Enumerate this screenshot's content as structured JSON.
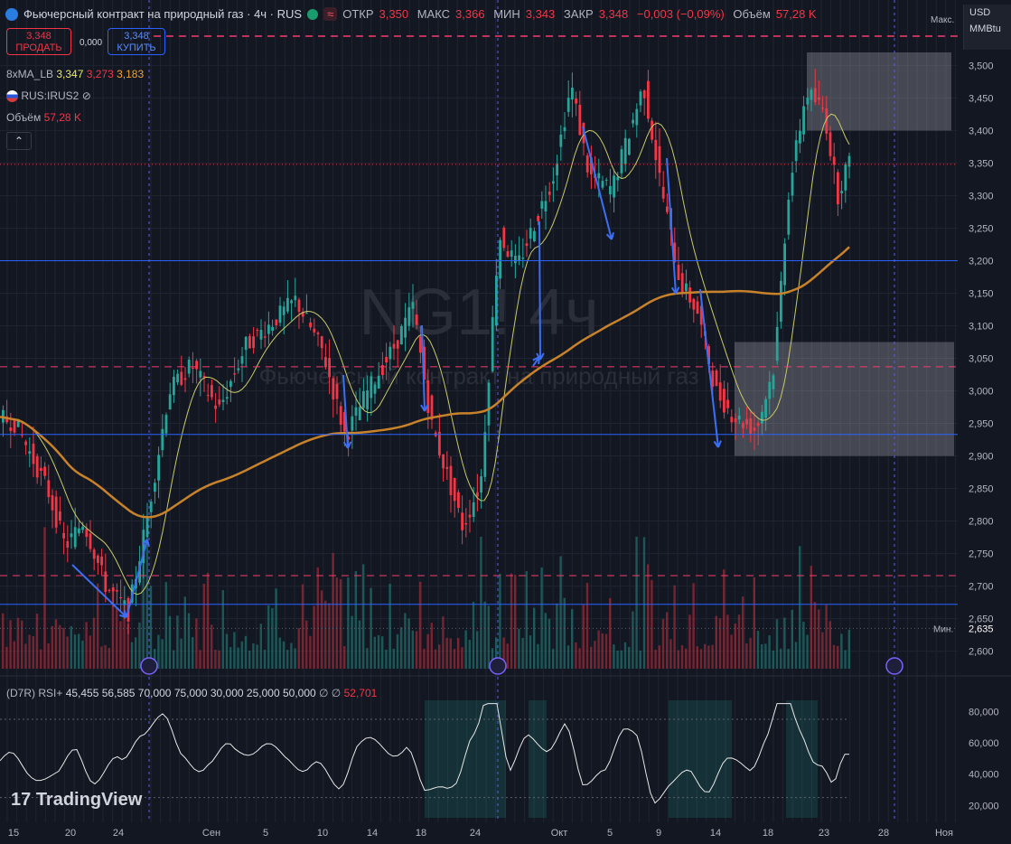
{
  "header": {
    "title": "Фьючерсный контракт на природный газ · 4ч · RUS",
    "open_label": "ОТКР",
    "open": "3,350",
    "high_label": "МАКС",
    "high": "3,366",
    "low_label": "МИН",
    "low": "3,343",
    "close_label": "ЗАКР",
    "close": "3,348",
    "change": "−0,003 (−0,09%)",
    "volume_label": "Объём",
    "volume": "57,28 K"
  },
  "trade": {
    "sell_price": "3,348",
    "sell_label": "ПРОДАТЬ",
    "spread": "0,000",
    "buy_price": "3,348",
    "buy_label": "КУПИТЬ"
  },
  "indicators": {
    "ma_name": "8xMA_LB",
    "ma1": "3,347",
    "ma2": "3,273",
    "ma3": "3,183",
    "compare_symbol": "RUS:IRUS2",
    "volume_label": "Объём",
    "volume_value": "57,28 K",
    "rsi_name": "(D7R) RSI+",
    "rsi_values": [
      "45,455",
      "56,585",
      "70,000",
      "75,000",
      "30,000",
      "25,000",
      "50,000"
    ],
    "rsi_symbols": "∅ ∅",
    "rsi_current": "52,701"
  },
  "currency": {
    "code": "USD",
    "unit": "MMBtu"
  },
  "watermark": {
    "symbol": "NG1! 4ч",
    "name": "Фьючерсный контракт на природный газ"
  },
  "branding": "TradingView",
  "colors": {
    "up": "#26a69a",
    "down": "#f23645",
    "ma_long": "#c8822a",
    "ma_mid": "#b02a3a",
    "ma_fast": "#c9c96a",
    "level": "#2962ff",
    "dash": "#f23d6b"
  },
  "chart_data": {
    "type": "candlestick",
    "price_axis": {
      "ticks": [
        "3,500",
        "3,450",
        "3,400",
        "3,350",
        "3,300",
        "3,250",
        "3,200",
        "3,150",
        "3,100",
        "3,050",
        "3,000",
        "2,950",
        "2,900",
        "2,850",
        "2,800",
        "2,750",
        "2,700",
        "2,650",
        "2,600"
      ],
      "max_label": "Макс.",
      "min_label": "Мин.",
      "min_value": "2,635"
    },
    "time_axis": [
      "15",
      "20",
      "24",
      "Сен",
      "5",
      "10",
      "14",
      "18",
      "24",
      "Окт",
      "5",
      "9",
      "14",
      "18",
      "23",
      "28",
      "Ноя"
    ],
    "price_labels": [
      {
        "value": "3,348",
        "kind": "current"
      },
      {
        "value": "3,200",
        "kind": "level"
      },
      {
        "value": "3,037",
        "kind": "dashed"
      },
      {
        "value": "2,933",
        "kind": "level"
      },
      {
        "value": "2,716",
        "kind": "dashed"
      },
      {
        "value": "2,672",
        "kind": "level"
      }
    ],
    "rsi_axis": [
      "80,000",
      "60,000",
      "40,000",
      "20,000"
    ],
    "close_path": [
      {
        "t": 0,
        "p": 2.96
      },
      {
        "t": 20,
        "p": 2.95
      },
      {
        "t": 55,
        "p": 2.85
      },
      {
        "t": 75,
        "p": 2.76
      },
      {
        "t": 95,
        "p": 2.8
      },
      {
        "t": 120,
        "p": 2.7
      },
      {
        "t": 145,
        "p": 2.66
      },
      {
        "t": 165,
        "p": 2.8
      },
      {
        "t": 190,
        "p": 3.0
      },
      {
        "t": 215,
        "p": 3.04
      },
      {
        "t": 245,
        "p": 2.97
      },
      {
        "t": 275,
        "p": 3.07
      },
      {
        "t": 300,
        "p": 3.1
      },
      {
        "t": 330,
        "p": 3.14
      },
      {
        "t": 360,
        "p": 3.06
      },
      {
        "t": 385,
        "p": 2.93
      },
      {
        "t": 410,
        "p": 3.0
      },
      {
        "t": 440,
        "p": 3.07
      },
      {
        "t": 460,
        "p": 3.13
      },
      {
        "t": 480,
        "p": 2.95
      },
      {
        "t": 500,
        "p": 2.86
      },
      {
        "t": 515,
        "p": 2.79
      },
      {
        "t": 535,
        "p": 2.86
      },
      {
        "t": 555,
        "p": 3.24
      },
      {
        "t": 575,
        "p": 3.19
      },
      {
        "t": 595,
        "p": 3.26
      },
      {
        "t": 615,
        "p": 3.33
      },
      {
        "t": 635,
        "p": 3.47
      },
      {
        "t": 655,
        "p": 3.33
      },
      {
        "t": 680,
        "p": 3.31
      },
      {
        "t": 700,
        "p": 3.4
      },
      {
        "t": 715,
        "p": 3.47
      },
      {
        "t": 735,
        "p": 3.31
      },
      {
        "t": 755,
        "p": 3.17
      },
      {
        "t": 775,
        "p": 3.12
      },
      {
        "t": 795,
        "p": 3.0
      },
      {
        "t": 815,
        "p": 2.96
      },
      {
        "t": 840,
        "p": 2.94
      },
      {
        "t": 860,
        "p": 3.04
      },
      {
        "t": 875,
        "p": 3.3
      },
      {
        "t": 895,
        "p": 3.46
      },
      {
        "t": 915,
        "p": 3.43
      },
      {
        "t": 930,
        "p": 3.3
      },
      {
        "t": 940,
        "p": 3.348
      }
    ]
  }
}
